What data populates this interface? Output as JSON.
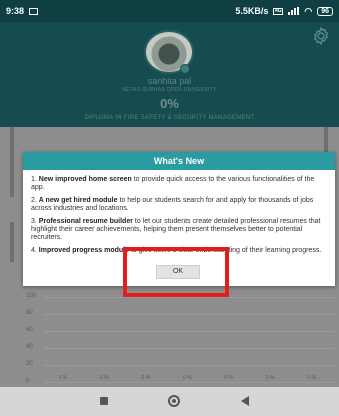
{
  "status_bar": {
    "time": "9:38",
    "network_speed": "5.5KB/s",
    "network_type": "4G",
    "battery": "96"
  },
  "profile": {
    "name": "sanhita pal",
    "university": "NETAJI SUBHAS OPEN UNIVERSITY",
    "progress": "0%",
    "course": "DIPLOMA IN FIRE SAFETY & SECURITY MANAGEMENT"
  },
  "dialog": {
    "title": "What's New",
    "items": [
      {
        "number": "1.",
        "bold": "New improved home screen",
        "text": " to provide quick access to the various functionalities of the app."
      },
      {
        "number": "2.",
        "bold": "A new get hired module",
        "text": " to help our students search for and apply for thousands of jobs across industries and locations."
      },
      {
        "number": "3.",
        "bold": "Professional resume builder",
        "text": " to let our students create detailed professional resumes that highlight their career achievements, helping them present themselves better to potential recruiters."
      },
      {
        "number": "4.",
        "bold": "Improved progress module",
        "text": " to give users a clear understanding of their learning progress."
      }
    ],
    "ok_label": "OK"
  },
  "chart_data": {
    "type": "bar",
    "y_ticks": [
      "100",
      "80",
      "60",
      "40",
      "20",
      "0"
    ],
    "x_labels": [
      "0 %",
      "0 %",
      "0 %",
      "0 %",
      "0 %",
      "0 %",
      "0 %"
    ],
    "values": [
      0,
      0,
      0,
      0,
      0,
      0,
      0
    ],
    "ylim": [
      0,
      100
    ]
  },
  "icons": {
    "settings": "gear-icon",
    "nav_recent": "square-icon",
    "nav_home": "circle-icon",
    "nav_back": "back-triangle-icon"
  },
  "colors": {
    "header": "#164c50",
    "dialog_title": "#2a9ba0",
    "highlight": "#e21d1d"
  }
}
